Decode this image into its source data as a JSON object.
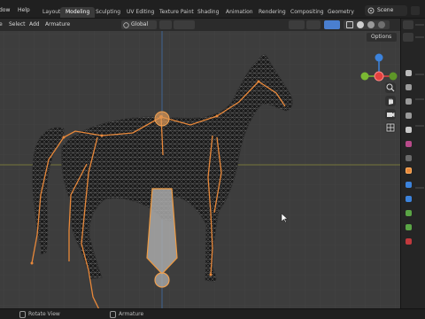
{
  "topbar": {
    "menus": [
      "dow",
      "Help"
    ],
    "workspaces": [
      "Layout",
      "Modeling",
      "Sculpting",
      "UV Editing",
      "Texture Paint",
      "Shading",
      "Animation",
      "Rendering",
      "Compositing",
      "Geometry N"
    ],
    "active_workspace": "Modeling",
    "scene_name": "Scene"
  },
  "viewport_header": {
    "items": [
      "e",
      "Select",
      "Add",
      "Armature"
    ],
    "transform_orientation": "Global",
    "options_label": "Options"
  },
  "gizmo": {
    "x_label": "X",
    "y_label": "Y",
    "z_label": "Z",
    "colors": {
      "x": "#e3413f",
      "y": "#7bb933",
      "z": "#3c83dc"
    }
  },
  "viewport_tools": [
    "zoom-icon",
    "hand-icon",
    "camera-icon",
    "grid-icon"
  ],
  "statusbar": {
    "left_action": "Rotate View",
    "mode_label": "Armature"
  },
  "colors": {
    "viewport_bg": "#3d3d3d",
    "bone_orange": "#e8883a",
    "accent_blue": "#4a7fd0"
  }
}
